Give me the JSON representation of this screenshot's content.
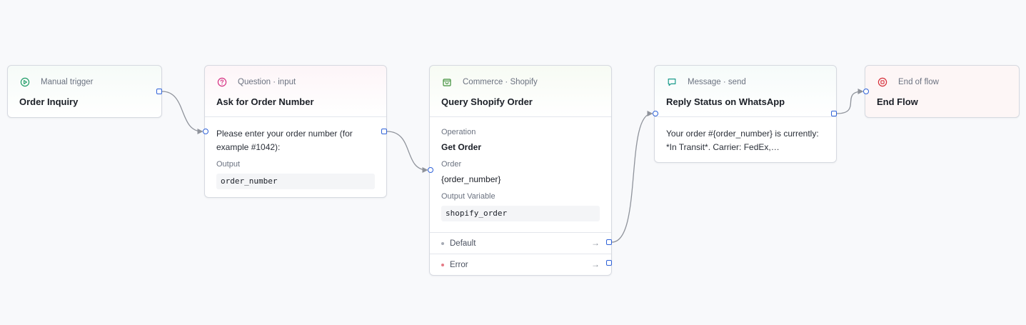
{
  "colors": {
    "port": "#2f62d8",
    "edge": "#8f939b",
    "trigger": "#1f9d67",
    "question": "#d63384",
    "commerce": "#3f8f3a",
    "message": "#1c9c8c",
    "end": "#d6303a",
    "default_dot": "#a6abb4",
    "error_dot": "#e57b86"
  },
  "nodes": {
    "trigger": {
      "kind": "Manual trigger",
      "icon": "play-circle-icon",
      "title": "Order Inquiry"
    },
    "question": {
      "kind": "Question · input",
      "icon": "question-circle-icon",
      "title": "Ask for Order Number",
      "prompt": "Please enter your order number (for example #1042):",
      "output_label": "Output",
      "output_value": "order_number"
    },
    "shopify": {
      "kind": "Commerce · Shopify",
      "icon": "shopping-bag-icon",
      "title": "Query Shopify Order",
      "operation_label": "Operation",
      "operation_value": "Get Order",
      "order_label": "Order",
      "order_value": "{order_number}",
      "output_var_label": "Output Variable",
      "output_var_value": "shopify_order",
      "branches": [
        {
          "label": "Default",
          "arrow": "→"
        },
        {
          "label": "Error",
          "arrow": "→"
        }
      ]
    },
    "message": {
      "kind": "Message · send",
      "icon": "chat-bubble-icon",
      "title": "Reply Status on WhatsApp",
      "text": "Your order #{order_number} is currently: *In Transit*. Carrier: FedEx,…"
    },
    "end": {
      "kind": "End of flow",
      "icon": "stop-circle-icon",
      "title": "End Flow"
    }
  }
}
